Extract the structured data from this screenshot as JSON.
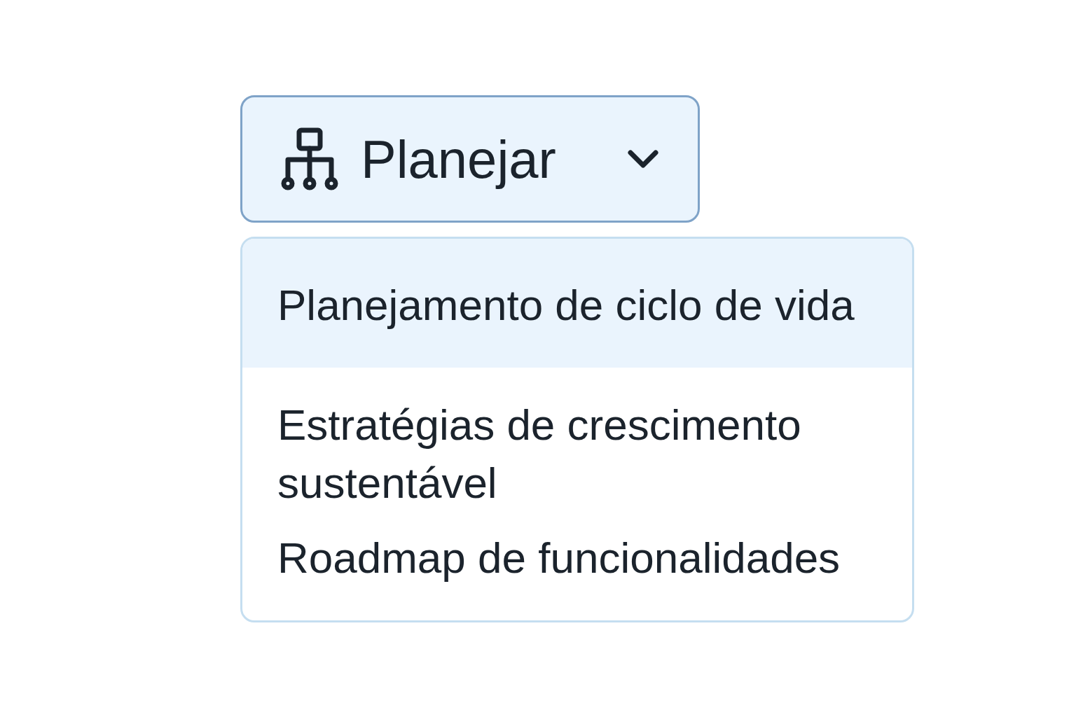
{
  "dropdown": {
    "label": "Planejar",
    "expanded": true
  },
  "menu_items": [
    {
      "label": "Planejamento de ciclo de vida",
      "selected": true
    },
    {
      "label": "Estratégias de crescimento sustentável",
      "selected": false
    },
    {
      "label": "Roadmap de funcionalidades",
      "selected": false
    }
  ]
}
